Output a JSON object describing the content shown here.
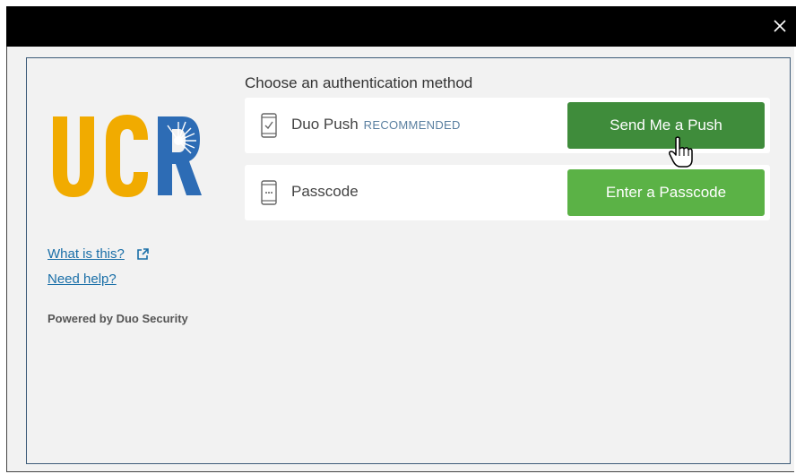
{
  "window": {
    "close_icon": "close-icon"
  },
  "brand": {
    "logo_text": "UCR",
    "colors": {
      "gold": "#F1AB00",
      "blue": "#2D6CB5"
    }
  },
  "sidebar": {
    "what_is_this": "What is this?",
    "need_help": "Need help?",
    "powered_by": "Powered by Duo Security"
  },
  "auth": {
    "heading": "Choose an authentication method",
    "methods": [
      {
        "label": "Duo Push",
        "badge": "RECOMMENDED",
        "button": "Send Me a Push",
        "icon": "phone-check-icon"
      },
      {
        "label": "Passcode",
        "badge": "",
        "button": "Enter a Passcode",
        "icon": "phone-keypad-icon"
      }
    ]
  },
  "colors": {
    "button_dark": "#3F8C3B",
    "button_light": "#5BB246",
    "link": "#1A6FA8"
  }
}
